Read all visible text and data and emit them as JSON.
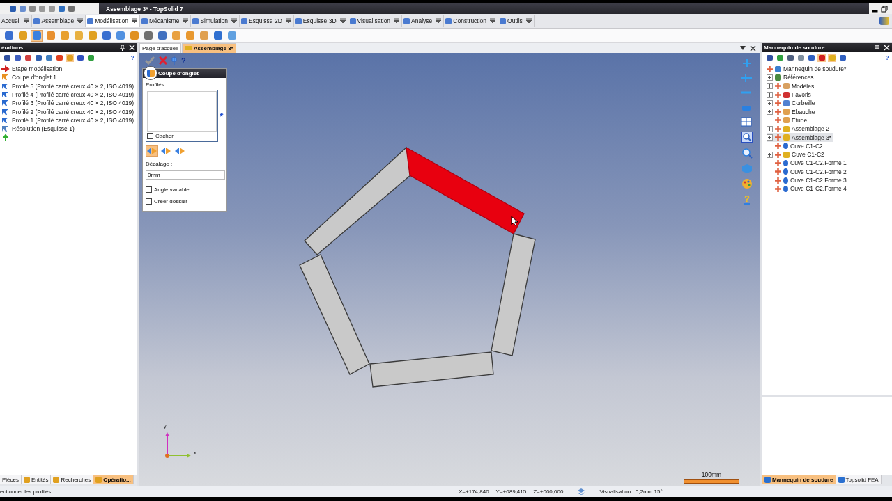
{
  "title_bar": {
    "title": "Assemblage 3* - TopSolid 7"
  },
  "ribbon_tabs": [
    {
      "label": "Accueil",
      "selected": false
    },
    {
      "label": "Assemblage",
      "selected": false
    },
    {
      "label": "Modélisation",
      "selected": true
    },
    {
      "label": "Mécanisme",
      "selected": false
    },
    {
      "label": "Simulation",
      "selected": false
    },
    {
      "label": "Esquisse 2D",
      "selected": false
    },
    {
      "label": "Esquisse 3D",
      "selected": false
    },
    {
      "label": "Visualisation",
      "selected": false
    },
    {
      "label": "Analyse",
      "selected": false
    },
    {
      "label": "Construction",
      "selected": false
    },
    {
      "label": "Outils",
      "selected": false
    }
  ],
  "operations_panel": {
    "title": "érations",
    "help": "?",
    "items": [
      {
        "label": "Etape modélisation",
        "kind": "step"
      },
      {
        "label": "Coupe d'onglet 1",
        "kind": "miter"
      },
      {
        "label": "Profilé 5 (Profilé carré creux 40 × 2, ISO 4019)",
        "kind": "profile"
      },
      {
        "label": "Profilé 4 (Profilé carré creux 40 × 2, ISO 4019)",
        "kind": "profile"
      },
      {
        "label": "Profilé 3 (Profilé carré creux 40 × 2, ISO 4019)",
        "kind": "profile"
      },
      {
        "label": "Profilé 2 (Profilé carré creux 40 × 2, ISO 4019)",
        "kind": "profile"
      },
      {
        "label": "Profilé 1 (Profilé carré creux 40 × 2, ISO 4019)",
        "kind": "profile"
      },
      {
        "label": "Résolution (Esquisse 1)",
        "kind": "resolution"
      },
      {
        "label": "--",
        "kind": "end"
      }
    ],
    "tabs": [
      {
        "label": "Pièces",
        "selected": false
      },
      {
        "label": "Entités",
        "selected": false
      },
      {
        "label": "Recherches",
        "selected": false
      },
      {
        "label": "Opératio...",
        "selected": true
      }
    ]
  },
  "document_tabs": [
    {
      "label": "Page d'accueil",
      "selected": false
    },
    {
      "label": "Assemblage 3*",
      "selected": true
    }
  ],
  "miter_dialog": {
    "title": "Coupe d'onglet",
    "help": "?",
    "profiles_label": "Profilés :",
    "required_mark": "*",
    "hide": {
      "label": "Cacher",
      "checked": false
    },
    "modes": [
      {
        "selected": true
      },
      {
        "selected": false
      },
      {
        "selected": false
      }
    ],
    "offset_label": "Décalage :",
    "offset_value": "0mm",
    "options": [
      {
        "label": "Angle variable",
        "checked": false
      },
      {
        "label": "Créer dossier",
        "checked": false
      }
    ]
  },
  "viewport": {
    "beams": [
      {
        "selected": false
      },
      {
        "selected": true
      },
      {
        "selected": false
      },
      {
        "selected": false
      },
      {
        "selected": false
      }
    ],
    "axis_y": "y",
    "axis_x": "x",
    "scale_label": "100mm",
    "help": "?"
  },
  "weld_panel": {
    "title": "Mannequin de soudure",
    "help": "?",
    "root": "Mannequin de soudure*",
    "tree": [
      {
        "label": "Références",
        "kind": "references",
        "expandable": true,
        "selected": false
      },
      {
        "label": "Modèles",
        "kind": "models",
        "expandable": true,
        "selected": false
      },
      {
        "label": "Favoris",
        "kind": "favorites",
        "expandable": true,
        "selected": false
      },
      {
        "label": "Corbeille",
        "kind": "trash",
        "expandable": true,
        "selected": false
      },
      {
        "label": "Ebauche",
        "kind": "folder",
        "expandable": true,
        "selected": false
      },
      {
        "label": "Etude",
        "kind": "folder",
        "expandable": false,
        "selected": false
      },
      {
        "label": "Assemblage 2",
        "kind": "assembly",
        "expandable": true,
        "selected": false
      },
      {
        "label": "Assemblage 3*",
        "kind": "assembly",
        "expandable": true,
        "selected": true
      },
      {
        "label": "Cuve C1-C2",
        "kind": "part",
        "expandable": false,
        "selected": false
      },
      {
        "label": "Cuve C1-C2",
        "kind": "assembly",
        "expandable": true,
        "selected": false
      },
      {
        "label": "Cuve C1-C2.Forme 1",
        "kind": "part",
        "expandable": false,
        "selected": false
      },
      {
        "label": "Cuve C1-C2.Forme 2",
        "kind": "part",
        "expandable": false,
        "selected": false
      },
      {
        "label": "Cuve C1-C2.Forme 3",
        "kind": "part",
        "expandable": false,
        "selected": false
      },
      {
        "label": "Cuve C1-C2.Forme 4",
        "kind": "part",
        "expandable": false,
        "selected": false
      }
    ],
    "tabs": [
      {
        "label": "Mannequin de soudure",
        "selected": true
      },
      {
        "label": "Topsolid FEA",
        "selected": false
      }
    ]
  },
  "status_bar": {
    "message": "ectionner les profilés.",
    "x": "X=+174,840",
    "y": "Y=+089,415",
    "z": "Z=+000,000",
    "visualisation": "Visualisation : 0,2mm 15°"
  }
}
